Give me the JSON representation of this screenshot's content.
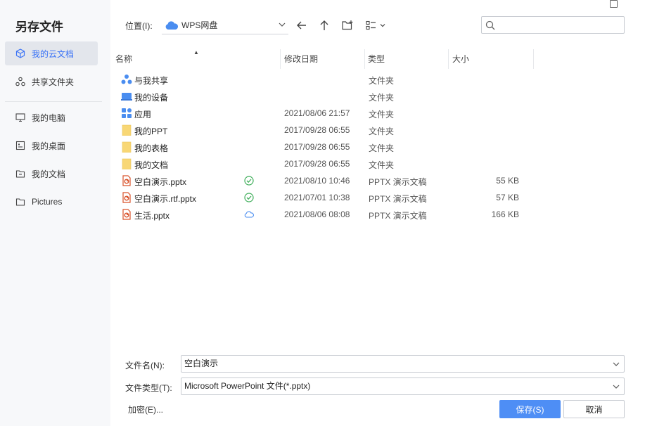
{
  "dialog": {
    "title": "另存文件"
  },
  "sidebar": {
    "items": [
      {
        "label": "我的云文档",
        "icon": "cloud-doc-icon",
        "active": true
      },
      {
        "label": "共享文件夹",
        "icon": "share-folder-icon",
        "active": false
      },
      {
        "label": "我的电脑",
        "icon": "computer-icon",
        "active": false
      },
      {
        "label": "我的桌面",
        "icon": "desktop-icon",
        "active": false
      },
      {
        "label": "我的文档",
        "icon": "documents-icon",
        "active": false
      },
      {
        "label": "Pictures",
        "icon": "folder-icon",
        "active": false
      }
    ]
  },
  "toolbar": {
    "location_label": "位置(I):",
    "location_value": "WPS网盘",
    "search_placeholder": ""
  },
  "list": {
    "headers": {
      "name": "名称",
      "modified": "修改日期",
      "type": "类型",
      "size": "大小"
    },
    "rows": [
      {
        "name": "与我共享",
        "date": "",
        "type": "文件夹",
        "size": "",
        "icon": "shared-with-me-icon",
        "sync": ""
      },
      {
        "name": "我的设备",
        "date": "",
        "type": "文件夹",
        "size": "",
        "icon": "device-icon",
        "sync": ""
      },
      {
        "name": "应用",
        "date": "2021/08/06 21:57",
        "type": "文件夹",
        "size": "",
        "icon": "apps-icon",
        "sync": ""
      },
      {
        "name": "我的PPT",
        "date": "2017/09/28 06:55",
        "type": "文件夹",
        "size": "",
        "icon": "folder-icon",
        "sync": ""
      },
      {
        "name": "我的表格",
        "date": "2017/09/28 06:55",
        "type": "文件夹",
        "size": "",
        "icon": "folder-icon",
        "sync": ""
      },
      {
        "name": "我的文档",
        "date": "2017/09/28 06:55",
        "type": "文件夹",
        "size": "",
        "icon": "folder-icon",
        "sync": ""
      },
      {
        "name": "空白演示.pptx",
        "date": "2021/08/10 10:46",
        "type": "PPTX 演示文稿",
        "size": "55 KB",
        "icon": "pptx-file-icon",
        "sync": "synced"
      },
      {
        "name": "空白演示.rtf.pptx",
        "date": "2021/07/01 10:38",
        "type": "PPTX 演示文稿",
        "size": "57 KB",
        "icon": "pptx-file-icon",
        "sync": "synced"
      },
      {
        "name": "生活.pptx",
        "date": "2021/08/06 08:08",
        "type": "PPTX 演示文稿",
        "size": "166 KB",
        "icon": "pptx-file-icon",
        "sync": "cloud"
      }
    ]
  },
  "form": {
    "filename_label": "文件名(N):",
    "filename_value": "空白演示",
    "filetype_label": "文件类型(T):",
    "filetype_value": "Microsoft PowerPoint 文件(*.pptx)",
    "encrypt_label": "加密(E)...",
    "save_label": "保存(S)",
    "cancel_label": "取消"
  },
  "colors": {
    "accent": "#4e8ef5",
    "active_text": "#3b73f6",
    "folder_yellow": "#f8d775",
    "pptx_orange": "#d9532c",
    "sync_green": "#3fae5a",
    "cloud_blue": "#4a8df0"
  }
}
